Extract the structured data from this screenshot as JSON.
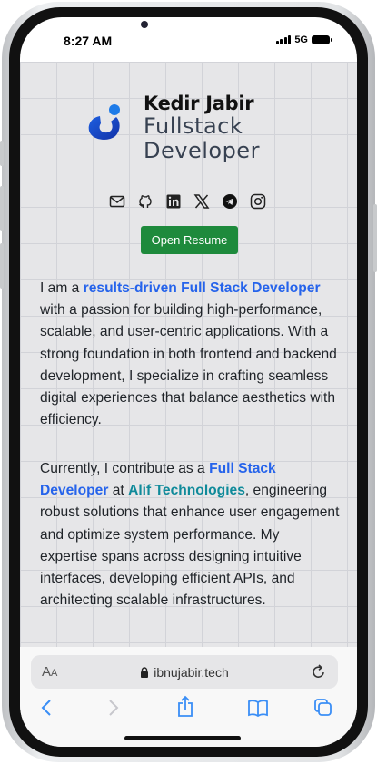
{
  "status": {
    "time": "8:27 AM",
    "network": "5G"
  },
  "hero": {
    "name": "Kedir Jabir",
    "role_line1": "Fullstack",
    "role_line2": "Developer"
  },
  "social": [
    "mail-icon",
    "github-icon",
    "linkedin-icon",
    "x-icon",
    "telegram-icon",
    "instagram-icon"
  ],
  "resume_label": "Open Resume",
  "para1": {
    "t1": "I am a ",
    "h1": "results-driven Full Stack Developer",
    "t2": " with a passion for building high-performance, scalable, and user-centric applications. With a strong foundation in both frontend and backend development, I specialize in crafting seamless digital experiences that balance aesthetics with efficiency."
  },
  "para2": {
    "t1": "Currently, I contribute as a ",
    "h1": "Full Stack Developer",
    "t2": " at ",
    "h2": "Alif Technologies",
    "t3": ", engineering robust solutions that enhance user engagement and optimize system performance. My expertise spans across designing intuitive interfaces, developing efficient APIs, and architecting scalable infrastructures."
  },
  "browser": {
    "aa": "A",
    "aa_small": "A",
    "url": "ibnujabir.tech"
  },
  "colors": {
    "accent": "#2563eb",
    "button": "#1e8a3c",
    "company": "#0f8a9a",
    "safari": "#3a8ef6"
  }
}
